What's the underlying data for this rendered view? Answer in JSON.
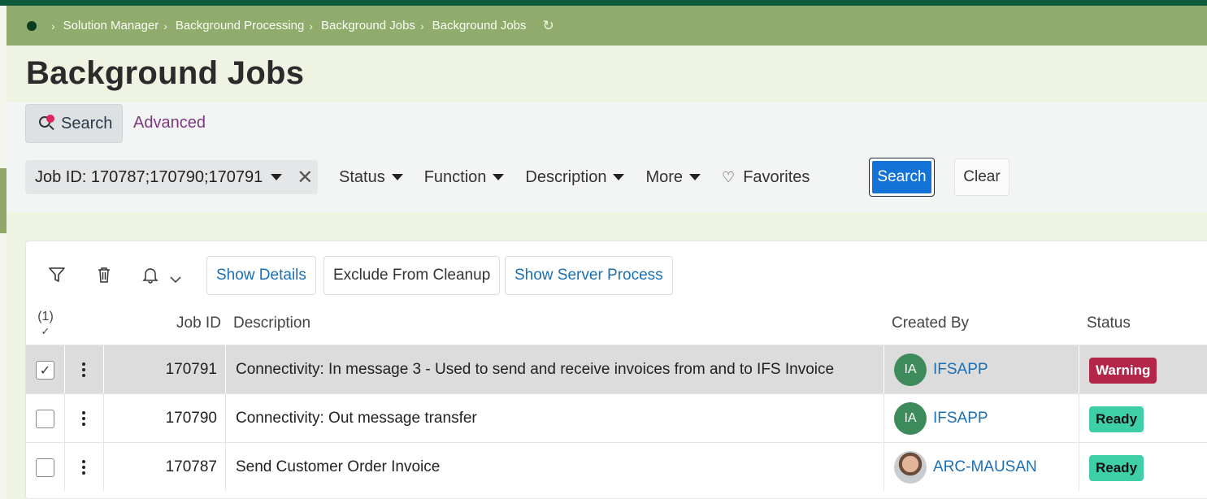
{
  "colors": {
    "brand_dark": "#0e5a3a",
    "breadcrumb_bg": "#8fac6c",
    "link": "#1a6fb5",
    "primary_button": "#1473d6",
    "warning": "#b5274a",
    "ready": "#3ecfa7"
  },
  "breadcrumb": {
    "items": [
      "Solution Manager",
      "Background Processing",
      "Background Jobs",
      "Background Jobs"
    ],
    "home_icon": "home-dot-icon",
    "refresh_icon": "refresh-icon"
  },
  "page": {
    "title": "Background Jobs"
  },
  "search": {
    "tab_search": "Search",
    "tab_advanced": "Advanced",
    "job_id_filter": "Job ID: 170787;170790;170791",
    "filters": [
      "Status",
      "Function",
      "Description",
      "More"
    ],
    "favorites": "Favorites",
    "search_button": "Search",
    "clear_button": "Clear"
  },
  "toolbar": {
    "filter_icon": "filter-icon",
    "delete_icon": "trash-icon",
    "notify_icon": "bell-icon",
    "show_details": "Show Details",
    "exclude_cleanup": "Exclude From Cleanup",
    "show_server_process": "Show Server Process"
  },
  "grid": {
    "selected_count": "(1)",
    "columns": {
      "job_id": "Job ID",
      "description": "Description",
      "created_by": "Created By",
      "status": "Status"
    },
    "rows": [
      {
        "job_id": "170791",
        "description": "Connectivity: In message 3 - Used to send and receive invoices from and to IFS Invoice",
        "created_by": "IFSAPP",
        "initials": "IA",
        "status": "Warning",
        "selected": true
      },
      {
        "job_id": "170790",
        "description": "Connectivity: Out message transfer",
        "created_by": "IFSAPP",
        "initials": "IA",
        "status": "Ready",
        "selected": false
      },
      {
        "job_id": "170787",
        "description": "Send Customer Order Invoice",
        "created_by": "ARC-MAUSAN",
        "initials": "",
        "status": "Ready",
        "selected": false
      }
    ]
  }
}
